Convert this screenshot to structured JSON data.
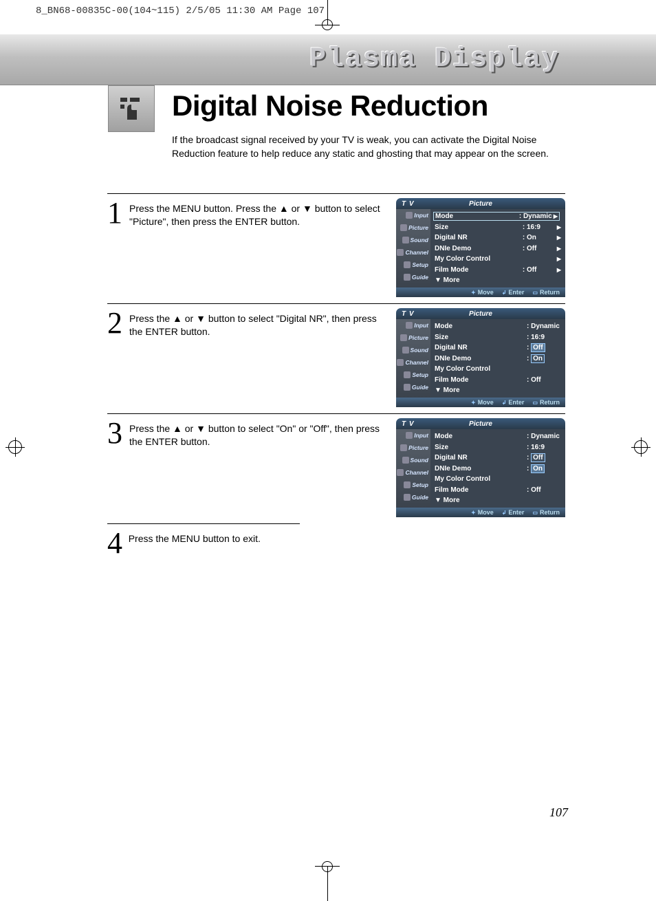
{
  "print_header": "8_BN68-00835C-00(104~115)  2/5/05  11:30 AM  Page 107",
  "banner_title": "Plasma Display",
  "page_title": "Digital Noise Reduction",
  "intro": "If the broadcast signal received by your TV is weak, you can activate the Digital Noise Reduction feature to help reduce any static and ghosting that may appear on the screen.",
  "page_number": "107",
  "steps": [
    {
      "num": "1",
      "text": "Press the MENU button. Press the ▲ or ▼ button to select \"Picture\", then press the ENTER button."
    },
    {
      "num": "2",
      "text": "Press the ▲ or ▼ button to select \"Digital NR\", then press the ENTER button."
    },
    {
      "num": "3",
      "text": "Press the ▲ or ▼ button to select \"On\" or \"Off\", then press the ENTER button."
    },
    {
      "num": "4",
      "text": "Press the MENU button to exit."
    }
  ],
  "osd_common": {
    "tv": "T V",
    "title": "Picture",
    "side": [
      "Input",
      "Picture",
      "Sound",
      "Channel",
      "Setup",
      "Guide"
    ],
    "more": "▼ More",
    "footer": {
      "move": "Move",
      "enter": "Enter",
      "return": "Return"
    }
  },
  "osd1": {
    "rows": [
      {
        "label": "Mode",
        "value": ": Dynamic",
        "arrow": "▶",
        "selected": true
      },
      {
        "label": "Size",
        "value": ": 16:9",
        "arrow": "▶"
      },
      {
        "label": "Digital NR",
        "value": ": On",
        "arrow": "▶"
      },
      {
        "label": "DNIe Demo",
        "value": ": Off",
        "arrow": "▶"
      },
      {
        "label": "My Color Control",
        "value": "",
        "arrow": "▶"
      },
      {
        "label": "Film Mode",
        "value": ": Off",
        "arrow": "▶"
      }
    ]
  },
  "osd2": {
    "rows": [
      {
        "label": "Mode",
        "value": ": Dynamic"
      },
      {
        "label": "Size",
        "value": ": 16:9"
      },
      {
        "label": "Digital NR",
        "value": ":",
        "boxed": "Off",
        "sel": true
      },
      {
        "label": "DNIe Demo",
        "value": ":",
        "boxed": "On"
      },
      {
        "label": "My Color Control",
        "value": ""
      },
      {
        "label": "Film Mode",
        "value": ": Off"
      }
    ]
  },
  "osd3": {
    "rows": [
      {
        "label": "Mode",
        "value": ": Dynamic"
      },
      {
        "label": "Size",
        "value": ": 16:9"
      },
      {
        "label": "Digital NR",
        "value": ":",
        "boxed": "Off"
      },
      {
        "label": "DNIe Demo",
        "value": ":",
        "boxed": "On",
        "sel": true
      },
      {
        "label": "My Color Control",
        "value": ""
      },
      {
        "label": "Film Mode",
        "value": ": Off"
      }
    ]
  }
}
